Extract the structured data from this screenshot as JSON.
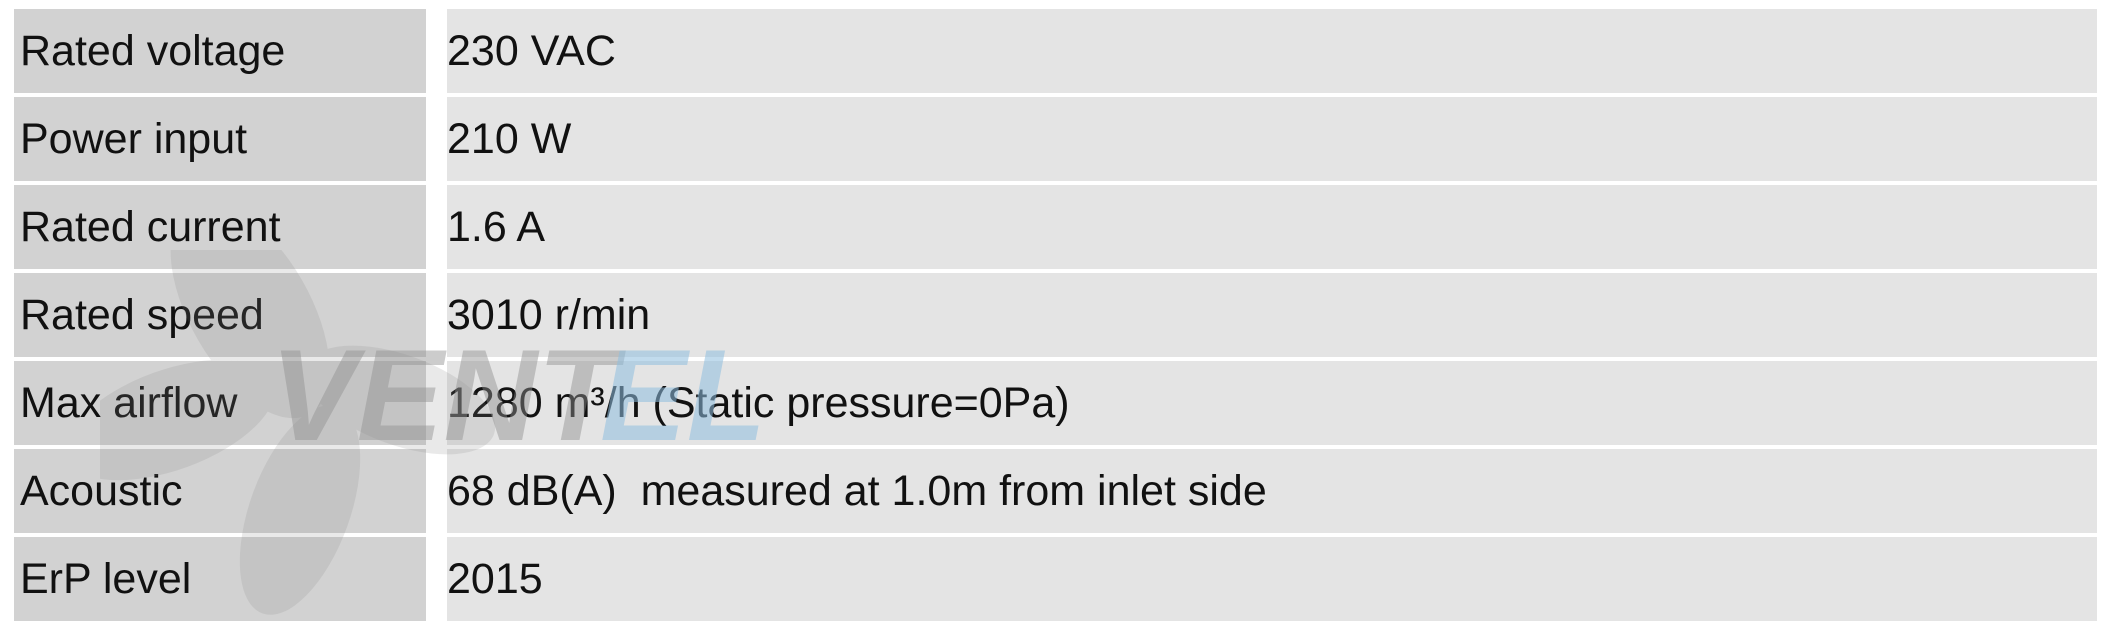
{
  "specs": [
    {
      "label": "Rated voltage",
      "value": "230 VAC"
    },
    {
      "label": "Power input",
      "value": "210 W"
    },
    {
      "label": "Rated current",
      "value": "1.6 A"
    },
    {
      "label": "Rated speed",
      "value": "3010 r/min"
    },
    {
      "label": "Max airflow",
      "value": "1280 m³/h (Static pressure=0Pa)"
    },
    {
      "label": "Acoustic",
      "value": "68 dB(A)  measured at 1.0m from inlet side"
    },
    {
      "label": "ErP level",
      "value": "2015"
    }
  ],
  "watermark": {
    "text": "VENTEL",
    "icon": "fan-icon",
    "colors": {
      "gray": "#a0a0a0",
      "blue": "#8fbfe0"
    }
  }
}
